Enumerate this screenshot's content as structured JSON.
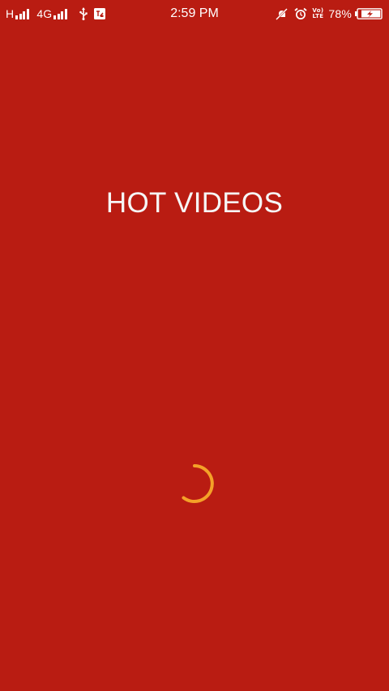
{
  "status_bar": {
    "carrier_left": "H",
    "network_type": "4G",
    "time": "2:59 PM",
    "volte_line1": "Vo)",
    "volte_line2": "LTE",
    "battery_percent": "78%",
    "icons": [
      "signal-icon",
      "usb-icon",
      "notification-icon",
      "mute-icon",
      "alarm-icon",
      "volte-icon",
      "battery-charging-icon"
    ]
  },
  "splash": {
    "title": "HOT VIDEOS",
    "background_color": "#b91c12",
    "spinner_color": "#f4a128",
    "loading_icon": "loading-spinner-icon"
  }
}
